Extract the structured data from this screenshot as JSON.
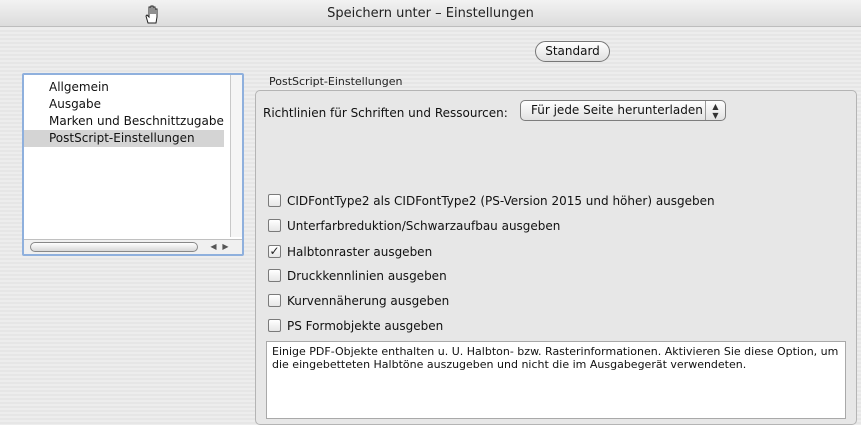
{
  "window": {
    "title": "Speichern unter – Einstellungen"
  },
  "toolbar": {
    "standard_label": "Standard"
  },
  "sidebar": {
    "items": [
      {
        "label": "Allgemein"
      },
      {
        "label": "Ausgabe"
      },
      {
        "label": "Marken und Beschnittzugabe"
      },
      {
        "label": "PostScript-Einstellungen",
        "selected": true
      }
    ]
  },
  "panel": {
    "section_title": "PostScript-Einstellungen",
    "policy_label": "Richtlinien für Schriften und Ressourcen:",
    "policy_value": "Für jede Seite herunterladen",
    "options": [
      {
        "label": "CIDFontType2 als CIDFontType2 (PS-Version 2015 und höher) ausgeben",
        "checked": false
      },
      {
        "label": "Unterfarbreduktion/Schwarzaufbau ausgeben",
        "checked": false
      },
      {
        "label": "Halbtonraster ausgeben",
        "checked": true
      },
      {
        "label": "Druckkennlinien ausgeben",
        "checked": false
      },
      {
        "label": "Kurvennäherung ausgeben",
        "checked": false
      },
      {
        "label": "PS Formobjekte ausgeben",
        "checked": false
      }
    ],
    "description": "Einige PDF-Objekte enthalten u. U. Halbton- bzw. Rasterinformationen. Aktivieren Sie diese Option, um die eingebetteten Halbtöne auszugeben und nicht die im Ausgabegerät verwendeten."
  },
  "icons": {
    "cursor": "hand-cursor-icon",
    "check": "checkmark-icon",
    "popup": "up-down-arrows-icon"
  }
}
